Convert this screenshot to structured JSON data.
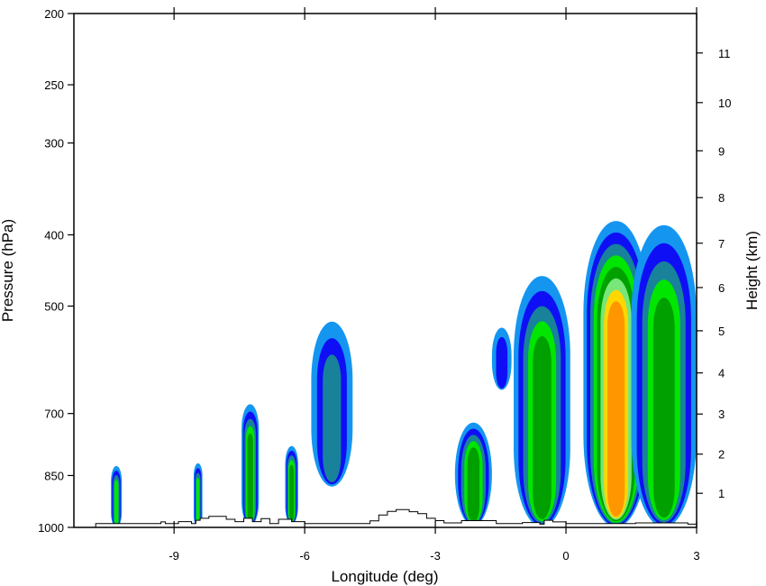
{
  "chart_data": {
    "type": "contour",
    "xlabel": "Longitude (deg)",
    "ylabel_left": "Pressure (hPa)",
    "ylabel_right": "Height (km)",
    "xlim": [
      -11.3,
      3.0
    ],
    "x_ticks": [
      -9,
      -6,
      -3,
      0,
      3
    ],
    "x_tick_labels": [
      "-9",
      "-6",
      "-3",
      "0",
      "3"
    ],
    "pressure_ticks": [
      200,
      250,
      300,
      400,
      500,
      700,
      850,
      1000
    ],
    "pressure_tick_labels": [
      "200",
      "250",
      "300",
      "400",
      "500",
      "700",
      "850",
      "1000"
    ],
    "pressure_range": [
      1000,
      200
    ],
    "height_ticks": [
      1,
      2,
      3,
      4,
      5,
      6,
      7,
      8,
      9,
      10,
      11
    ],
    "height_tick_labels": [
      "1",
      "2",
      "3",
      "4",
      "5",
      "6",
      "7",
      "8",
      "9",
      "10",
      "11"
    ],
    "level_colors": [
      "#1496f0",
      "#0f0ff5",
      "#18829b",
      "#00e600",
      "#00a000",
      "#78e678",
      "#ffd700",
      "#ff9600"
    ],
    "terrain_outline": [
      [
        -11.3,
        1000
      ],
      [
        -10.8,
        1000
      ],
      [
        -10.8,
        988
      ],
      [
        -9.3,
        988
      ],
      [
        -9.3,
        983
      ],
      [
        -9.2,
        983
      ],
      [
        -9.2,
        988
      ],
      [
        -8.9,
        988
      ],
      [
        -8.9,
        982
      ],
      [
        -8.6,
        982
      ],
      [
        -8.6,
        988
      ],
      [
        -8.5,
        988
      ],
      [
        -8.5,
        978
      ],
      [
        -8.4,
        978
      ],
      [
        -8.4,
        972
      ],
      [
        -8.2,
        972
      ],
      [
        -8.2,
        966
      ],
      [
        -7.8,
        966
      ],
      [
        -7.8,
        975
      ],
      [
        -7.6,
        975
      ],
      [
        -7.6,
        982
      ],
      [
        -7.4,
        982
      ],
      [
        -7.4,
        972
      ],
      [
        -7.2,
        972
      ],
      [
        -7.2,
        982
      ],
      [
        -7.0,
        982
      ],
      [
        -7.0,
        973
      ],
      [
        -6.8,
        973
      ],
      [
        -6.8,
        988
      ],
      [
        -6.6,
        988
      ],
      [
        -6.6,
        975
      ],
      [
        -6.3,
        975
      ],
      [
        -6.3,
        982
      ],
      [
        -6.0,
        982
      ],
      [
        -6.0,
        988
      ],
      [
        -4.5,
        988
      ],
      [
        -4.5,
        980
      ],
      [
        -4.3,
        980
      ],
      [
        -4.3,
        962
      ],
      [
        -4.1,
        962
      ],
      [
        -4.1,
        951
      ],
      [
        -3.9,
        951
      ],
      [
        -3.9,
        946
      ],
      [
        -3.6,
        946
      ],
      [
        -3.6,
        952
      ],
      [
        -3.4,
        952
      ],
      [
        -3.4,
        958
      ],
      [
        -3.2,
        958
      ],
      [
        -3.2,
        972
      ],
      [
        -3.0,
        972
      ],
      [
        -3.0,
        979
      ],
      [
        -2.8,
        979
      ],
      [
        -2.8,
        986
      ],
      [
        -2.4,
        986
      ],
      [
        -2.4,
        979
      ],
      [
        -1.6,
        979
      ],
      [
        -1.6,
        988
      ],
      [
        -1.0,
        988
      ],
      [
        -1.0,
        985
      ],
      [
        -0.6,
        985
      ],
      [
        -0.6,
        990
      ],
      [
        -0.5,
        990
      ],
      [
        -0.5,
        978
      ],
      [
        -0.3,
        978
      ],
      [
        -0.3,
        983
      ],
      [
        0.0,
        983
      ],
      [
        0.0,
        988
      ],
      [
        1.6,
        988
      ],
      [
        1.6,
        986
      ],
      [
        2.8,
        986
      ],
      [
        2.8,
        990
      ],
      [
        3.0,
        990
      ],
      [
        3.0,
        1000
      ]
    ],
    "cells": [
      {
        "x_min": -10.45,
        "x_max": -10.2,
        "p_bottom": 1000,
        "p_top": 825,
        "levels": 4
      },
      {
        "x_min": -8.55,
        "x_max": -8.35,
        "p_bottom": 1000,
        "p_top": 818,
        "levels": 4
      },
      {
        "x_min": -7.45,
        "x_max": -7.05,
        "p_bottom": 995,
        "p_top": 680,
        "levels": 5
      },
      {
        "x_min": -6.45,
        "x_max": -6.15,
        "p_bottom": 990,
        "p_top": 775,
        "levels": 5
      },
      {
        "x_min": -5.85,
        "x_max": -4.9,
        "p_bottom": 880,
        "p_top": 525,
        "levels": 3
      },
      {
        "x_min": -2.55,
        "x_max": -1.7,
        "p_bottom": 995,
        "p_top": 720,
        "levels": 5
      },
      {
        "x_min": -1.7,
        "x_max": -1.25,
        "p_bottom": 650,
        "p_top": 535,
        "levels": 2
      },
      {
        "x_min": -1.2,
        "x_max": 0.1,
        "p_bottom": 1000,
        "p_top": 455,
        "levels": 5
      },
      {
        "x_min": 0.4,
        "x_max": 1.9,
        "p_bottom": 1000,
        "p_top": 383,
        "levels": 8
      },
      {
        "x_min": 1.5,
        "x_max": 3.0,
        "p_bottom": 1000,
        "p_top": 388,
        "levels": 5
      }
    ]
  }
}
